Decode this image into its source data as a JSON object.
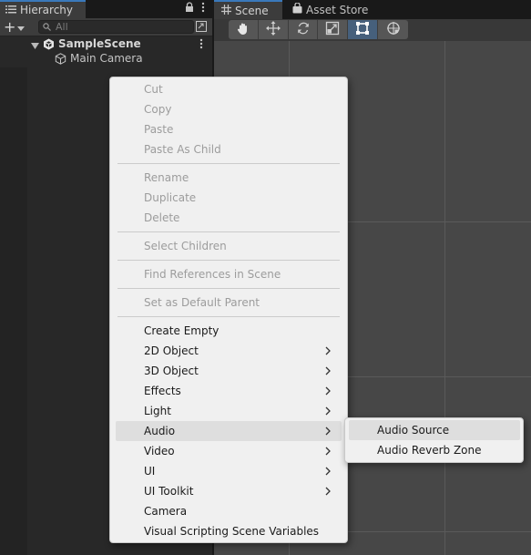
{
  "hierarchy": {
    "tab_title": "Hierarchy",
    "search_placeholder": "All",
    "add_label": "+",
    "scene_name": "SampleScene",
    "objects": [
      "Main Camera"
    ]
  },
  "scene_panel": {
    "tabs": [
      {
        "label": "Scene",
        "icon": "grid-icon",
        "active": true
      },
      {
        "label": "Asset Store",
        "icon": "bag-icon",
        "active": false
      }
    ],
    "tools": [
      "hand-tool",
      "move-tool",
      "rotate-tool",
      "scale-tool",
      "rect-tool",
      "transform-tool"
    ],
    "active_tool": "rect-tool"
  },
  "context_menu": {
    "clipboard": [
      "Cut",
      "Copy",
      "Paste",
      "Paste As Child"
    ],
    "edit": [
      "Rename",
      "Duplicate",
      "Delete"
    ],
    "select": "Select Children",
    "find": "Find References in Scene",
    "parent": "Set as Default Parent",
    "create": [
      {
        "label": "Create Empty",
        "submenu": false
      },
      {
        "label": "2D Object",
        "submenu": true
      },
      {
        "label": "3D Object",
        "submenu": true
      },
      {
        "label": "Effects",
        "submenu": true
      },
      {
        "label": "Light",
        "submenu": true
      },
      {
        "label": "Audio",
        "submenu": true,
        "highlighted": true
      },
      {
        "label": "Video",
        "submenu": true
      },
      {
        "label": "UI",
        "submenu": true
      },
      {
        "label": "UI Toolkit",
        "submenu": true
      },
      {
        "label": "Camera",
        "submenu": false
      },
      {
        "label": "Visual Scripting Scene Variables",
        "submenu": false
      }
    ]
  },
  "audio_submenu": {
    "items": [
      "Audio Source",
      "Audio Reverb Zone"
    ],
    "highlighted": "Audio Source"
  },
  "colors": {
    "accent": "#3a79bb",
    "menu_bg": "#f0f0f0",
    "menu_highlight": "#dedede",
    "disabled_text": "#9c9c9c"
  }
}
